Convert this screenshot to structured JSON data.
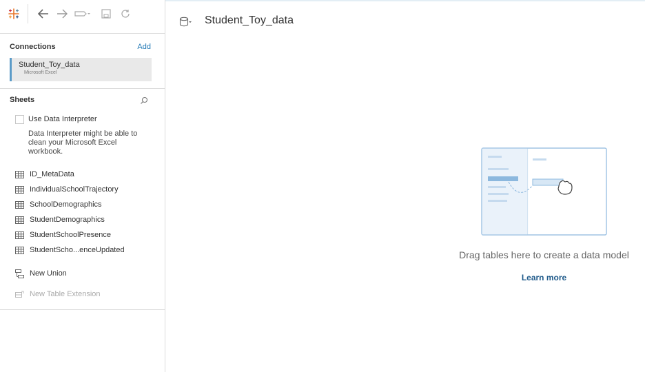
{
  "colors": {
    "accent": "#5b9bc8",
    "link": "#1f77b4",
    "learn_more": "#1f5a8a",
    "panel_border": "#dcdcdc",
    "selected_bg": "#e9e9e9"
  },
  "toolbar": {
    "icons": [
      "tableau-logo-icon",
      "back-arrow-icon",
      "forward-arrow-icon",
      "data-source-dropdown-icon",
      "save-icon",
      "refresh-icon"
    ]
  },
  "connections": {
    "title": "Connections",
    "add_label": "Add",
    "items": [
      {
        "name": "Student_Toy_data",
        "type": "Microsoft Excel"
      }
    ]
  },
  "sheets": {
    "title": "Sheets",
    "data_interpreter": {
      "label": "Use Data Interpreter",
      "checked": false,
      "description": "Data Interpreter might be able to clean your Microsoft Excel workbook."
    },
    "items": [
      {
        "label": "ID_MetaData"
      },
      {
        "label": "IndividualSchoolTrajectory"
      },
      {
        "label": "SchoolDemographics"
      },
      {
        "label": "StudentDemographics"
      },
      {
        "label": "StudentSchoolPresence"
      },
      {
        "label": "StudentScho...enceUpdated"
      }
    ],
    "new_union_label": "New Union",
    "new_table_extension_label": "New Table Extension"
  },
  "canvas": {
    "datasource_title": "Student_Toy_data",
    "empty_message": "Drag tables here to create a data model",
    "learn_more_label": "Learn more"
  }
}
